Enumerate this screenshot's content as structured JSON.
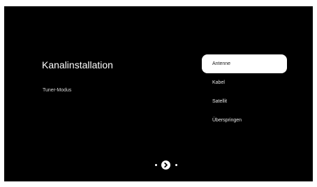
{
  "screen": {
    "title": "Kanalinstallation",
    "subtitle": "Tuner-Modus"
  },
  "options": [
    {
      "label": "Antenne",
      "selected": true
    },
    {
      "label": "Kabel",
      "selected": false
    },
    {
      "label": "Satellit",
      "selected": false
    },
    {
      "label": "Überspringen",
      "selected": false
    }
  ],
  "pager": {
    "next_icon": "chevron-right-icon"
  }
}
